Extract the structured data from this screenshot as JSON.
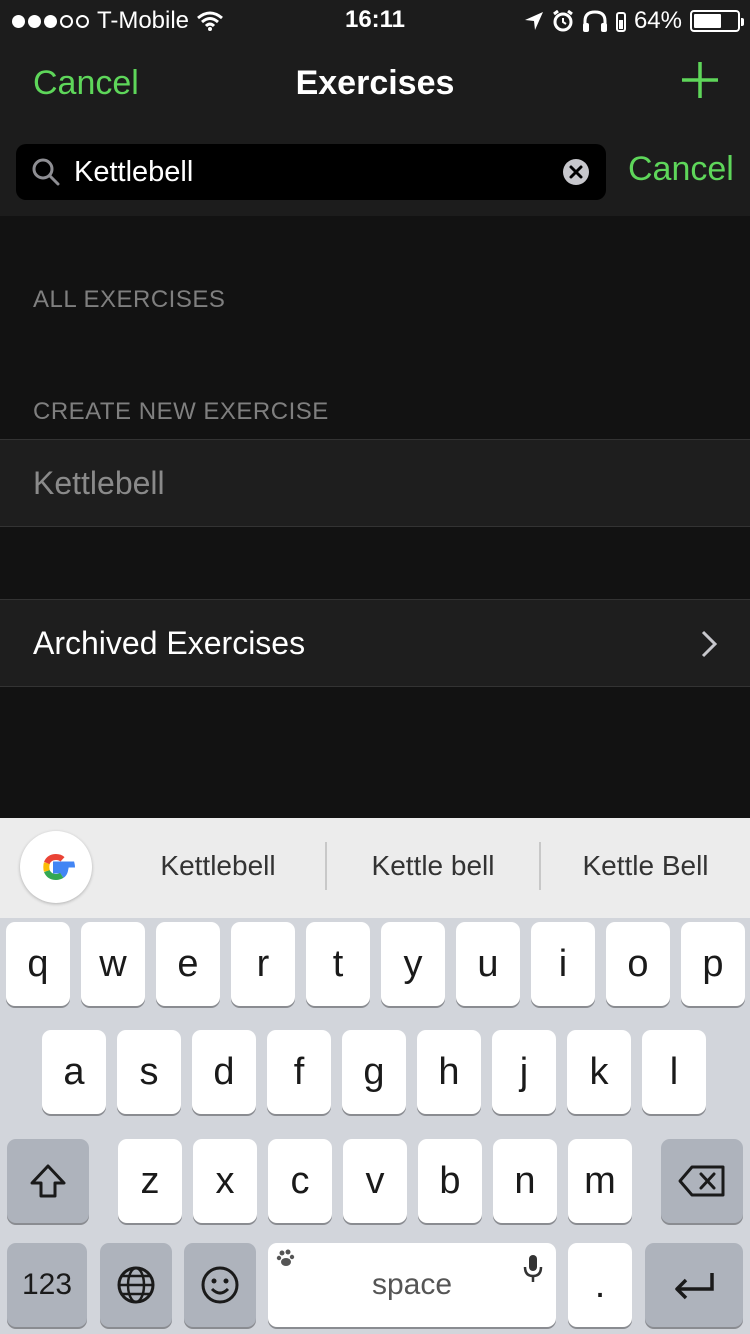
{
  "status_bar": {
    "carrier": "T-Mobile",
    "signal_bars_filled": 3,
    "signal_bars_total": 5,
    "time": "16:11",
    "battery_percent": "64%",
    "battery_level": 0.64
  },
  "nav": {
    "cancel_label": "Cancel",
    "title": "Exercises",
    "add_icon": "plus-icon"
  },
  "search": {
    "value": "Kettlebell",
    "cancel_label": "Cancel"
  },
  "sections": {
    "all_exercises_header": "ALL EXERCISES",
    "create_new_header": "CREATE NEW EXERCISE",
    "create_new_item": "Kettlebell",
    "archived_label": "Archived Exercises"
  },
  "keyboard": {
    "suggestions": [
      "Kettlebell",
      "Kettle bell",
      "Kettle Bell"
    ],
    "row1": [
      "q",
      "w",
      "e",
      "r",
      "t",
      "y",
      "u",
      "i",
      "o",
      "p"
    ],
    "row2": [
      "a",
      "s",
      "d",
      "f",
      "g",
      "h",
      "j",
      "k",
      "l"
    ],
    "row3": [
      "z",
      "x",
      "c",
      "v",
      "b",
      "n",
      "m"
    ],
    "numbers_label": "123",
    "space_label": "space",
    "period_label": "."
  },
  "colors": {
    "accent": "#5ed65a",
    "background": "#121212",
    "bar_background": "#1c1c1c"
  }
}
